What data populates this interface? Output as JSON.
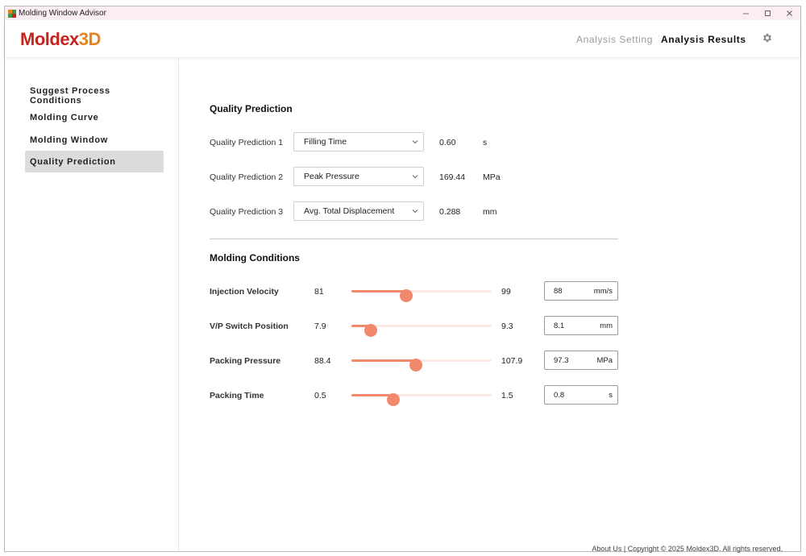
{
  "window": {
    "title": "Molding Window Advisor"
  },
  "header": {
    "logo_part1": "Moldex",
    "logo_part2": "3D",
    "tabs": [
      {
        "label": "Analysis Setting",
        "active": false
      },
      {
        "label": "Analysis Results",
        "active": true
      }
    ],
    "settings_icon": "gear-icon"
  },
  "sidebar": {
    "items": [
      {
        "label": "Suggest Process Conditions",
        "selected": false
      },
      {
        "label": "Molding Curve",
        "selected": false
      },
      {
        "label": "Molding Window",
        "selected": false
      },
      {
        "label": "Quality Prediction",
        "selected": true
      }
    ]
  },
  "quality_prediction": {
    "title": "Quality Prediction",
    "rows": [
      {
        "label": "Quality Prediction 1",
        "selected": "Filling Time",
        "value": "0.60",
        "unit": "s"
      },
      {
        "label": "Quality Prediction 2",
        "selected": "Peak Pressure",
        "value": "169.44",
        "unit": "MPa"
      },
      {
        "label": "Quality Prediction 3",
        "selected": "Avg. Total Displacement",
        "value": "0.288",
        "unit": "mm"
      }
    ]
  },
  "molding_conditions": {
    "title": "Molding Conditions",
    "rows": [
      {
        "label": "Injection Velocity",
        "min": "81",
        "max": "99",
        "value": "88",
        "unit": "mm/s",
        "fraction": 0.39
      },
      {
        "label": "V/P Switch Position",
        "min": "7.9",
        "max": "9.3",
        "value": "8.1",
        "unit": "mm",
        "fraction": 0.14
      },
      {
        "label": "Packing Pressure",
        "min": "88.4",
        "max": "107.9",
        "value": "97.3",
        "unit": "MPa",
        "fraction": 0.46
      },
      {
        "label": "Packing Time",
        "min": "0.5",
        "max": "1.5",
        "value": "0.8",
        "unit": "s",
        "fraction": 0.3
      }
    ]
  },
  "footer": {
    "about_label": "About Us",
    "separator": " | ",
    "copyright": "Copyright © 2025 Moldex3D. All rights reserved."
  },
  "colors": {
    "accent": "#f2896c",
    "track": "#fce9e3",
    "logo_red": "#c6251f",
    "logo_orange": "#e8841f"
  }
}
